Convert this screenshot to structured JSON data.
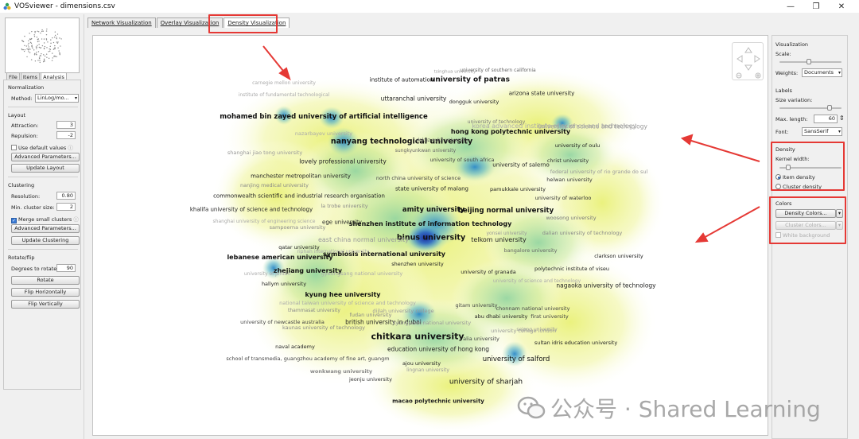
{
  "window": {
    "title": "VOSviewer - dimensions.csv",
    "min_glyph": "—",
    "max_glyph": "❐",
    "close_glyph": "✕"
  },
  "left_tabs": [
    "File",
    "Items",
    "Analysis"
  ],
  "normalization": {
    "section": "Normalization",
    "method_label": "Method:",
    "method_value": "LinLog/mo..."
  },
  "layout": {
    "section": "Layout",
    "attraction_label": "Attraction:",
    "attraction_value": "3",
    "repulsion_label": "Repulsion:",
    "repulsion_value": "-2",
    "use_default": "Use default values",
    "advanced": "Advanced Parameters...",
    "update": "Update Layout"
  },
  "clustering": {
    "section": "Clustering",
    "resolution_label": "Resolution:",
    "resolution_value": "0.80",
    "min_cluster_label": "Min. cluster size:",
    "min_cluster_value": "2",
    "merge_small": "Merge small clusters",
    "advanced": "Advanced Parameters...",
    "update": "Update Clustering"
  },
  "rotate": {
    "section": "Rotate/flip",
    "degrees_label": "Degrees to rotate:",
    "degrees_value": "90",
    "rotate": "Rotate",
    "flip_h": "Flip Horizontally",
    "flip_v": "Flip Vertically"
  },
  "main_tabs": [
    "Network Visualization",
    "Overlay Visualization",
    "Density Visualization"
  ],
  "right": {
    "visualization": "Visualization",
    "scale": "Scale:",
    "weights_label": "Weights:",
    "weights_value": "Documents",
    "labels": "Labels",
    "size_variation": "Size variation:",
    "max_length_label": "Max. length:",
    "max_length_value": "60",
    "font_label": "Font:",
    "font_value": "SansSerif",
    "density": "Density",
    "kernel_width": "Kernel width:",
    "item_density": "Item density",
    "cluster_density": "Cluster density",
    "colors": "Colors",
    "density_colors": "Density Colors...",
    "cluster_colors": "Cluster Colors...",
    "white_bg": "White background"
  },
  "watermark": "公众号 · Shared Learning",
  "map_labels": [
    {
      "t": "university of southern california",
      "c": "#666"
    },
    {
      "t": "institute of automation",
      "c": "#111"
    },
    {
      "t": "university of patras",
      "c": "#111"
    },
    {
      "t": "arizona state university",
      "c": "#222"
    },
    {
      "t": "uttaranchal university",
      "c": "#222"
    },
    {
      "t": "dongguk university",
      "c": "#222"
    },
    {
      "t": "mohamed bin zayed university of artificial intelligence",
      "c": "#111"
    },
    {
      "t": "university of technology",
      "c": "#777"
    },
    {
      "t": "hong kong polytechnic university",
      "c": "#111"
    },
    {
      "t": "university of science and technology",
      "c": "#999"
    },
    {
      "t": "nanyang technological university",
      "c": "#111"
    },
    {
      "t": "sungkyunkwan university",
      "c": "#666"
    },
    {
      "t": "shanghai jiao tong university",
      "c": "#999"
    },
    {
      "t": "university of oulu",
      "c": "#222"
    },
    {
      "t": "lovely professional university",
      "c": "#222"
    },
    {
      "t": "university of south africa",
      "c": "#444"
    },
    {
      "t": "christ university",
      "c": "#333"
    },
    {
      "t": "university of salerno",
      "c": "#222"
    },
    {
      "t": "federal university of rio grande do sul",
      "c": "#999"
    },
    {
      "t": "manchester metropolitan university",
      "c": "#222"
    },
    {
      "t": "north china university of science",
      "c": "#444"
    },
    {
      "t": "helwan university",
      "c": "#333"
    },
    {
      "t": "nanjing medical university",
      "c": "#888"
    },
    {
      "t": "state university of malang",
      "c": "#222"
    },
    {
      "t": "pamukkale university",
      "c": "#222"
    },
    {
      "t": "commonwealth scientific and industrial research organisation",
      "c": "#222"
    },
    {
      "t": "university of waterloo",
      "c": "#333"
    },
    {
      "t": "khalifa university of science and technology",
      "c": "#222"
    },
    {
      "t": "amity university",
      "c": "#111"
    },
    {
      "t": "beijing normal university",
      "c": "#111"
    },
    {
      "t": "woosong university",
      "c": "#777"
    },
    {
      "t": "ege university",
      "c": "#222"
    },
    {
      "t": "shenzhen institute of information technology",
      "c": "#111"
    },
    {
      "t": "sampoerna university",
      "c": "#888"
    },
    {
      "t": "dalian university of technology",
      "c": "#888"
    },
    {
      "t": "binus university",
      "c": "#111"
    },
    {
      "t": "east china normal university",
      "c": "#999"
    },
    {
      "t": "telkom university",
      "c": "#222"
    },
    {
      "t": "qatar university",
      "c": "#222"
    },
    {
      "t": "bangalore university",
      "c": "#666"
    },
    {
      "t": "symbiosis international university",
      "c": "#111"
    },
    {
      "t": "lebanese american university",
      "c": "#111"
    },
    {
      "t": "clarkson university",
      "c": "#222"
    },
    {
      "t": "shenzhen university",
      "c": "#222"
    },
    {
      "t": "zhejiang university",
      "c": "#111"
    },
    {
      "t": "polytechnic institute of viseu",
      "c": "#222"
    },
    {
      "t": "university of granada",
      "c": "#222"
    },
    {
      "t": "hallym university",
      "c": "#222"
    },
    {
      "t": "nagaoka university of technology",
      "c": "#222"
    },
    {
      "t": "kyung hee university",
      "c": "#111"
    },
    {
      "t": "gitam university",
      "c": "#444"
    },
    {
      "t": "chonnam national university",
      "c": "#444"
    },
    {
      "t": "fudan university",
      "c": "#888"
    },
    {
      "t": "abu dhabi university",
      "c": "#222"
    },
    {
      "t": "firat university",
      "c": "#444"
    },
    {
      "t": "university of newcastle australia",
      "c": "#444"
    },
    {
      "t": "british university in dubai",
      "c": "#222"
    },
    {
      "t": "chitkara university",
      "c": "#111"
    },
    {
      "t": "university college london",
      "c": "#999"
    },
    {
      "t": "naval academy",
      "c": "#222"
    },
    {
      "t": "sultan idris education university",
      "c": "#222"
    },
    {
      "t": "education university of hong kong",
      "c": "#222"
    },
    {
      "t": "school of transmedia, guangzhou academy of fine art, guangm",
      "c": "#444"
    },
    {
      "t": "ajou university",
      "c": "#222"
    },
    {
      "t": "university of salford",
      "c": "#111"
    },
    {
      "t": "wonkwang university",
      "c": "#888"
    },
    {
      "t": "jeonju university",
      "c": "#333"
    },
    {
      "t": "university of sharjah",
      "c": "#111"
    },
    {
      "t": "macao polytechnic university",
      "c": "#222"
    },
    {
      "t": "tsinghua university",
      "c": "#999"
    },
    {
      "t": "carnegie mellon university",
      "c": "#aaa"
    },
    {
      "t": "institute of fundamental technological",
      "c": "#aaa"
    },
    {
      "t": "korea advanced institute of science and technology",
      "c": "#aaa"
    },
    {
      "t": "nazarbayev university",
      "c": "#aaa"
    },
    {
      "t": "dokuz eylul university",
      "c": "#666"
    },
    {
      "t": "la trobe university",
      "c": "#888"
    },
    {
      "t": "shanghai university of engineering science",
      "c": "#aaa"
    },
    {
      "t": "gyeongsang national university",
      "c": "#aaa"
    },
    {
      "t": "national taiwan university of science and technology",
      "c": "#aaa"
    },
    {
      "t": "kaunas university of technology",
      "c": "#888"
    },
    {
      "t": "dijlah university college",
      "c": "#999"
    },
    {
      "t": "kyungpook national university",
      "c": "#999"
    },
    {
      "t": "sejong university",
      "c": "#999"
    },
    {
      "t": "thammasat university",
      "c": "#888"
    },
    {
      "t": "lingnan university",
      "c": "#999"
    },
    {
      "t": "yonsei university",
      "c": "#999"
    },
    {
      "t": "riphah international university",
      "c": "#aaa"
    },
    {
      "t": "university of jordan",
      "c": "#aaa"
    },
    {
      "t": "alia university",
      "c": "#444"
    },
    {
      "t": "university of science and technology",
      "c": "#aaa"
    }
  ]
}
